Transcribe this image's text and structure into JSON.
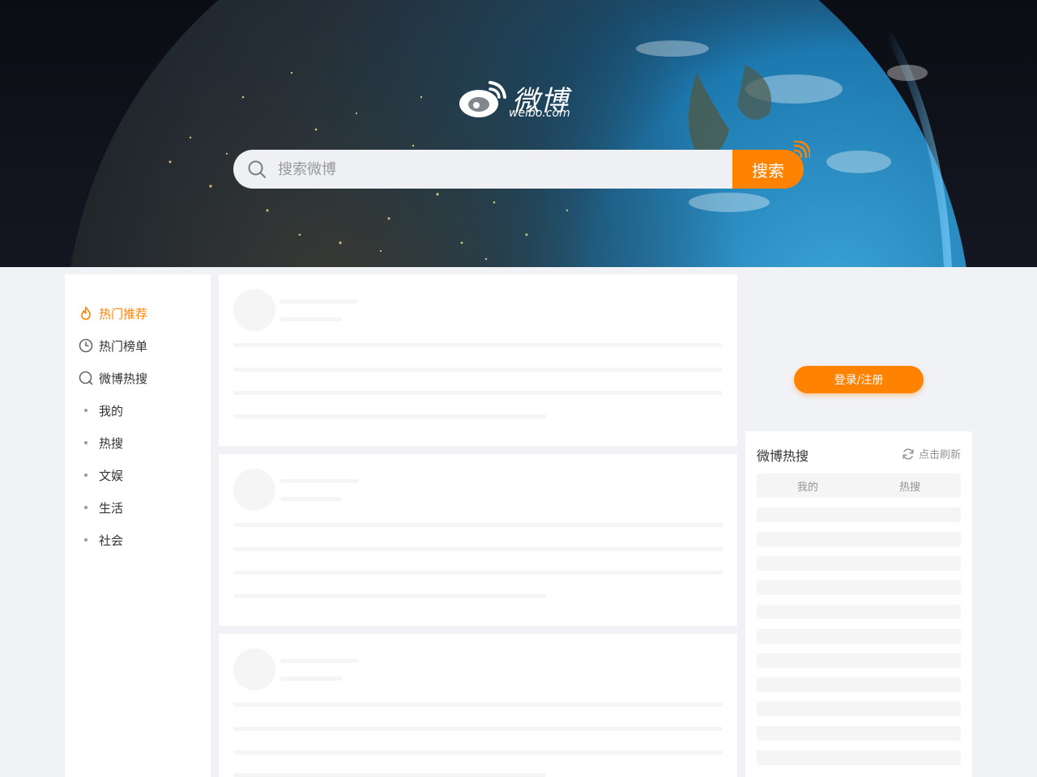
{
  "header": {
    "logo_cn": "微博",
    "logo_en": "weibo.com",
    "search_placeholder": "搜索微博",
    "search_button": "搜索"
  },
  "nav": {
    "items": [
      {
        "label": "热门推荐",
        "icon": "flame-icon",
        "active": true
      },
      {
        "label": "热门榜单",
        "icon": "clock-icon",
        "active": false
      },
      {
        "label": "微博热搜",
        "icon": "search-circle-icon",
        "active": false
      },
      {
        "label": "我的",
        "icon": "dot-icon",
        "active": false
      },
      {
        "label": "热搜",
        "icon": "dot-icon",
        "active": false
      },
      {
        "label": "文娱",
        "icon": "dot-icon",
        "active": false
      },
      {
        "label": "生活",
        "icon": "dot-icon",
        "active": false
      },
      {
        "label": "社会",
        "icon": "dot-icon",
        "active": false
      }
    ]
  },
  "sidebar": {
    "login_button": "登录/注册",
    "hot_title": "微博热搜",
    "refresh_label": "点击刷新",
    "tabs": [
      "我的",
      "热搜"
    ]
  },
  "colors": {
    "accent": "#ff8200",
    "page_bg": "#f0f2f5",
    "skeleton": "#f5f5f5"
  }
}
